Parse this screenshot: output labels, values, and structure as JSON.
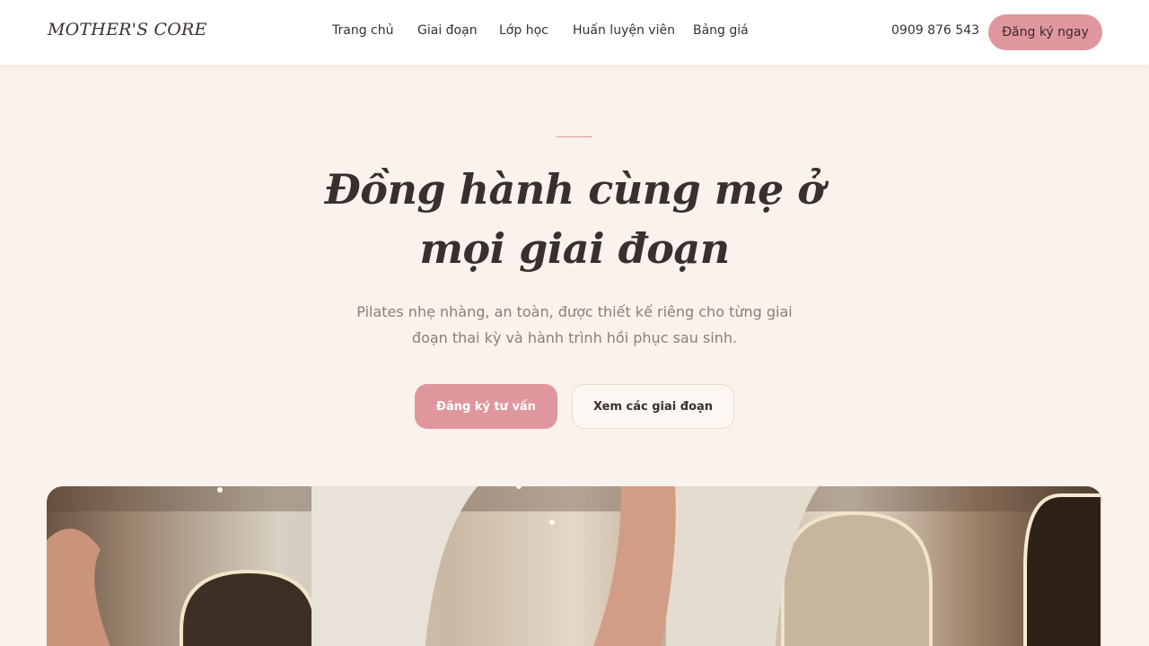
{
  "brand": {
    "logo": "MOTHER'S CORE"
  },
  "nav": {
    "items": [
      {
        "label": "Trang chủ"
      },
      {
        "label": "Giai đoạn"
      },
      {
        "label": "Lớp học"
      },
      {
        "label": "Huấn luyện viên"
      },
      {
        "label": "Bảng giá"
      }
    ]
  },
  "contact": {
    "phone": "0909 876 543"
  },
  "header": {
    "cta_label": "Đăng ký ngay"
  },
  "hero": {
    "title_line1": "Đồng hành cùng mẹ ở",
    "title_line2": "mọi giai đoạn",
    "subtitle_line1": "Pilates nhẹ nhàng, an toàn, được thiết kế riêng cho từng giai",
    "subtitle_line2": "đoạn thai kỳ và hành trình hồi phục sau sinh.",
    "primary_cta": "Đăng ký tư vấn",
    "secondary_cta": "Xem các giai đoạn"
  },
  "colors": {
    "accent": "#e0969d",
    "background": "#faf2ed",
    "text": "#3a3030",
    "muted": "#8f7b7b"
  }
}
